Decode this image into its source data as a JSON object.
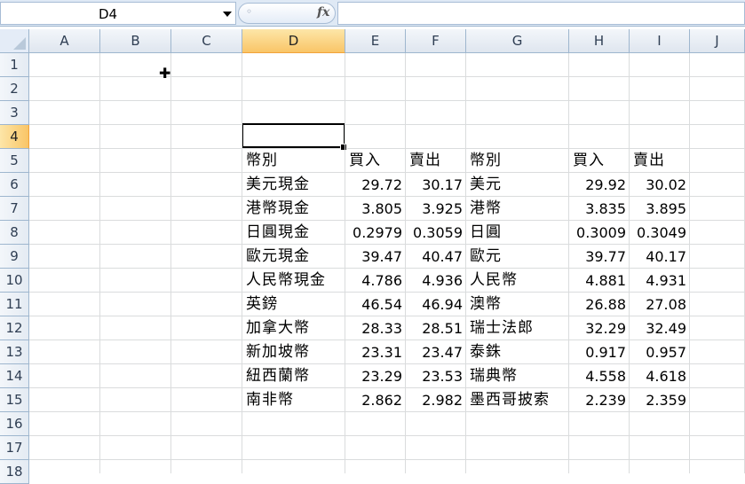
{
  "name_box": "D4",
  "formula_bar": {
    "fx_label": "fx",
    "dots": "◦",
    "value": ""
  },
  "columns": [
    "A",
    "B",
    "C",
    "D",
    "E",
    "F",
    "G",
    "H",
    "I",
    "J"
  ],
  "selected_column": "D",
  "rows": [
    "1",
    "2",
    "3",
    "4",
    "5",
    "6",
    "7",
    "8",
    "9",
    "10",
    "11",
    "12",
    "13",
    "14",
    "15",
    "16",
    "17",
    "18"
  ],
  "selected_row": "4",
  "table": {
    "headers": {
      "D": "幣別",
      "E": "買入",
      "F": "賣出",
      "G": "幣別",
      "H": "買入",
      "I": "賣出"
    },
    "rows": [
      {
        "D": "美元現金",
        "E": "29.72",
        "F": "30.17",
        "G": "美元",
        "H": "29.92",
        "I": "30.02"
      },
      {
        "D": "港幣現金",
        "E": "3.805",
        "F": "3.925",
        "G": "港幣",
        "H": "3.835",
        "I": "3.895"
      },
      {
        "D": "日圓現金",
        "E": "0.2979",
        "F": "0.3059",
        "G": "日圓",
        "H": "0.3009",
        "I": "0.3049"
      },
      {
        "D": "歐元現金",
        "E": "39.47",
        "F": "40.47",
        "G": "歐元",
        "H": "39.77",
        "I": "40.17"
      },
      {
        "D": "人民幣現金",
        "E": "4.786",
        "F": "4.936",
        "G": "人民幣",
        "H": "4.881",
        "I": "4.931"
      },
      {
        "D": "英鎊",
        "E": "46.54",
        "F": "46.94",
        "G": "澳幣",
        "H": "26.88",
        "I": "27.08"
      },
      {
        "D": "加拿大幣",
        "E": "28.33",
        "F": "28.51",
        "G": "瑞士法郎",
        "H": "32.29",
        "I": "32.49"
      },
      {
        "D": "新加坡幣",
        "E": "23.31",
        "F": "23.47",
        "G": "泰銖",
        "H": "0.917",
        "I": "0.957"
      },
      {
        "D": "紐西蘭幣",
        "E": "23.29",
        "F": "23.53",
        "G": "瑞典幣",
        "H": "4.558",
        "I": "4.618"
      },
      {
        "D": "南非幣",
        "E": "2.862",
        "F": "2.982",
        "G": "墨西哥披索",
        "H": "2.239",
        "I": "2.359"
      }
    ]
  },
  "colors": {
    "header_bg": "#dfe6ef",
    "selected_header": "#f9c567",
    "gridline": "#dadcdd"
  }
}
